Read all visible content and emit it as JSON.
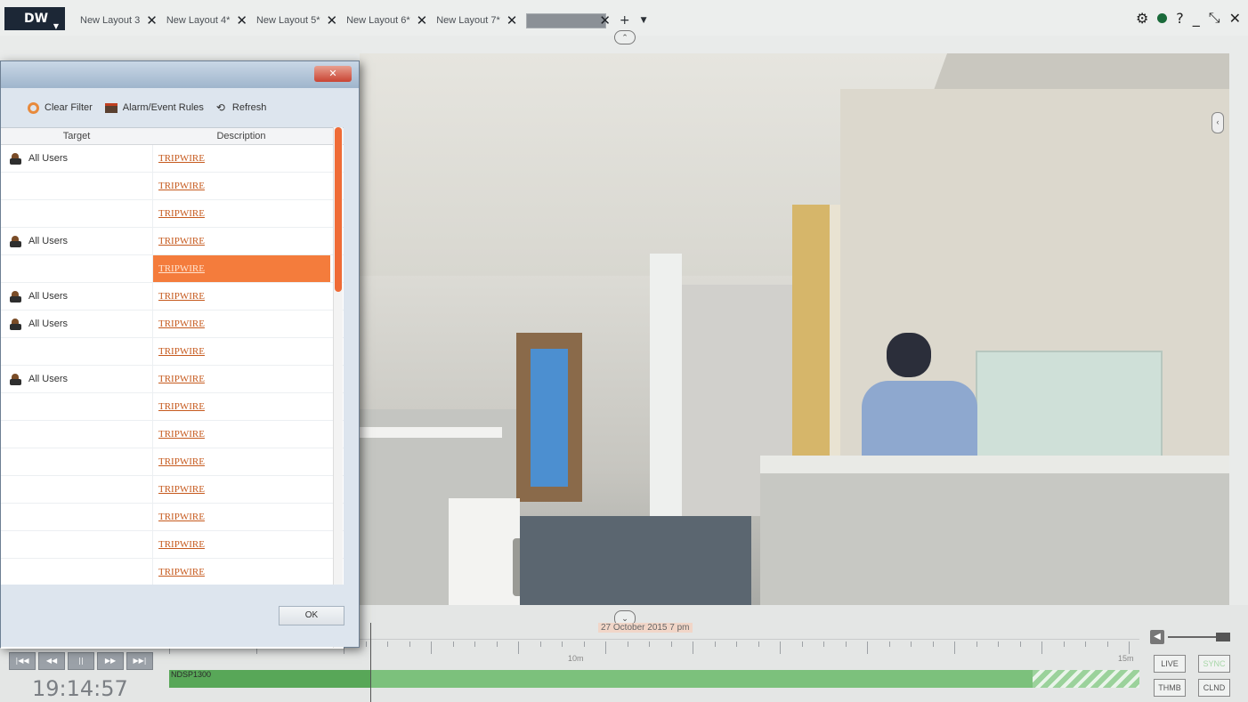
{
  "app": {
    "logo": "DW"
  },
  "tabs": [
    {
      "label": "New Layout 3"
    },
    {
      "label": "New Layout 4*"
    },
    {
      "label": "New Layout 5*"
    },
    {
      "label": "New Layout 6*"
    },
    {
      "label": "New Layout 7*"
    }
  ],
  "dialog": {
    "toolbar": {
      "clear_filter": "Clear Filter",
      "alarm_rules": "Alarm/Event Rules",
      "refresh": "Refresh"
    },
    "columns": {
      "target": "Target",
      "description": "Description"
    },
    "rows": [
      {
        "target": "All Users",
        "description": "TRIPWIRE"
      },
      {
        "target": "",
        "description": "TRIPWIRE"
      },
      {
        "target": "",
        "description": "TRIPWIRE"
      },
      {
        "target": "All Users",
        "description": "TRIPWIRE"
      },
      {
        "target": "",
        "description": "TRIPWIRE",
        "selected": true
      },
      {
        "target": "All Users",
        "description": "TRIPWIRE"
      },
      {
        "target": "All Users",
        "description": "TRIPWIRE"
      },
      {
        "target": "",
        "description": "TRIPWIRE"
      },
      {
        "target": "All Users",
        "description": "TRIPWIRE"
      },
      {
        "target": "",
        "description": "TRIPWIRE"
      },
      {
        "target": "",
        "description": "TRIPWIRE"
      },
      {
        "target": "",
        "description": "TRIPWIRE"
      },
      {
        "target": "",
        "description": "TRIPWIRE"
      },
      {
        "target": "",
        "description": "TRIPWIRE"
      },
      {
        "target": "",
        "description": "TRIPWIRE"
      },
      {
        "target": "",
        "description": "TRIPWIRE"
      }
    ],
    "ok_label": "OK"
  },
  "timeline": {
    "date_label": "27 October 2015 7 pm",
    "tick_labels": [
      "10m",
      "15m"
    ],
    "track_name": "NDSP1300",
    "clock": "19:14:57",
    "transport": [
      "|◀◀",
      "◀◀",
      "||",
      "▶▶",
      "▶▶|"
    ],
    "buttons": {
      "live": "LIVE",
      "sync": "SYNC",
      "thmb": "THMB",
      "clnd": "CLND"
    }
  },
  "colors": {
    "accent": "#f47c3c",
    "track": "#7cc17c",
    "logo_bg": "#1c2736"
  }
}
